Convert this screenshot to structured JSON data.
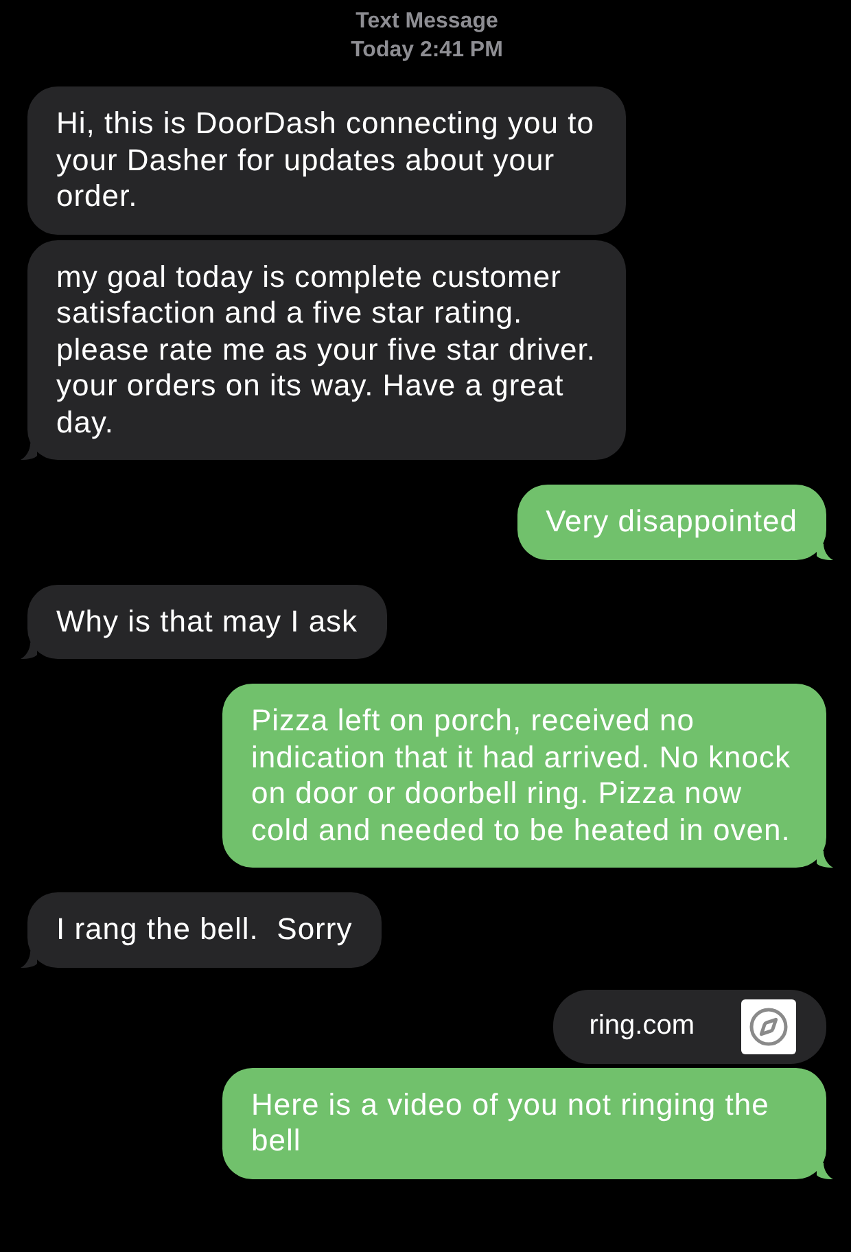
{
  "header": {
    "service": "Text Message",
    "time": "Today 2:41 PM"
  },
  "messages": [
    {
      "kind": "text",
      "outgoing": false,
      "tail": false,
      "text": "Hi, this is DoorDash connecting you to your Dasher for updates about your order."
    },
    {
      "kind": "text",
      "outgoing": false,
      "tail": true,
      "text": "my goal today is complete customer satisfaction and a five star rating. please rate me as your five star driver.  your orders on its way. Have a great day."
    },
    {
      "kind": "text",
      "outgoing": true,
      "tail": true,
      "text": "Very disappointed"
    },
    {
      "kind": "text",
      "outgoing": false,
      "tail": true,
      "text": "Why is that may I ask"
    },
    {
      "kind": "text",
      "outgoing": true,
      "tail": true,
      "text": "Pizza left on porch, received no indication that it had arrived. No knock on door or doorbell ring. Pizza now cold and needed to be heated in oven."
    },
    {
      "kind": "text",
      "outgoing": false,
      "tail": true,
      "text": "I rang the bell.  Sorry"
    },
    {
      "kind": "link",
      "outgoing": true,
      "tail": false,
      "text": "ring.com"
    },
    {
      "kind": "text",
      "outgoing": true,
      "tail": true,
      "text": "Here is a video of you not ringing the bell"
    }
  ]
}
